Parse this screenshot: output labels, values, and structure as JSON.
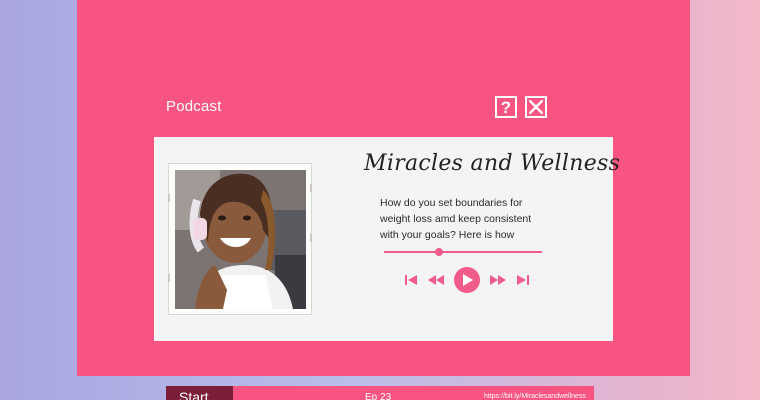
{
  "window": {
    "title": "Podcast",
    "help_icon": "question-mark-icon",
    "close_icon": "close-x-icon"
  },
  "card": {
    "heading": "Miracles and Wellness",
    "description": "How do you set boundaries for weight loss amd keep consistent with your goals? Here is how",
    "photo_icon": "host-portrait",
    "playback_progress_percent": 35
  },
  "player": {
    "controls": [
      "skip-back-icon",
      "rewind-icon",
      "play-icon",
      "fast-forward-icon",
      "skip-forward-icon"
    ]
  },
  "taskbar": {
    "start_label": "Start",
    "episode": "Ep 23",
    "url": "https://bit.ly/Miraclesandwellness"
  },
  "colors": {
    "window_bg": "#f75481",
    "accent": "#f25c8a",
    "card_bg": "#f4f4f4",
    "start_bg": "#7b1e3a"
  }
}
